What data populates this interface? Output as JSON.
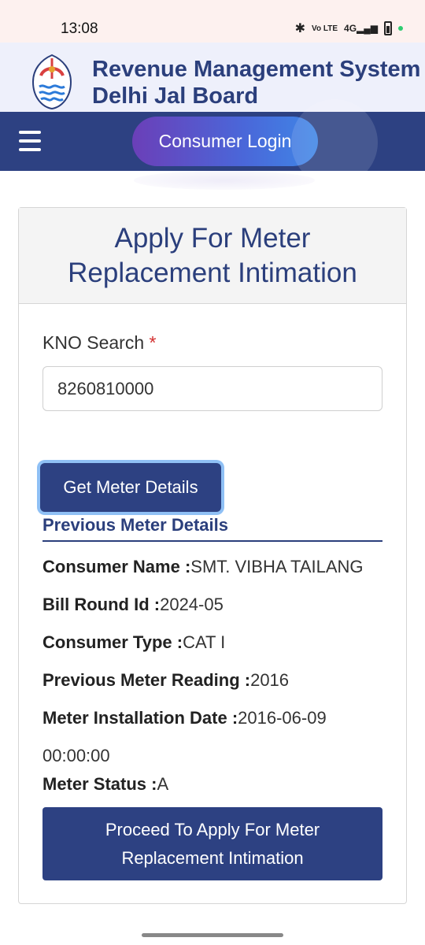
{
  "status_bar": {
    "time": "13:08",
    "icons": [
      "bluetooth-icon",
      "volte-icon",
      "signal-icon",
      "battery-icon"
    ],
    "volte_text": "Vo LTE",
    "network_text": "4G"
  },
  "header": {
    "title": "Revenue Management System",
    "subtitle": "Delhi Jal Board",
    "logo": "delhi-jal-board-logo"
  },
  "navbar": {
    "menu_icon": "hamburger-menu-icon",
    "login_label": "Consumer Login"
  },
  "form": {
    "title_line1": "Apply For Meter",
    "title_line2": "Replacement Intimation",
    "kno_label": "KNO Search",
    "required_mark": "*",
    "kno_value": "8260810000",
    "get_button": "Get Meter Details",
    "section_title": "Previous Meter Details"
  },
  "details": {
    "consumer_name_label": "Consumer Name :",
    "consumer_name_value": "SMT. VIBHA TAILANG",
    "bill_round_label": "Bill Round Id :",
    "bill_round_value": "2024-05",
    "consumer_type_label": "Consumer Type :",
    "consumer_type_value": "CAT I",
    "prev_reading_label": "Previous Meter Reading :",
    "prev_reading_value": "2016",
    "install_date_label": "Meter Installation Date :",
    "install_date_value": "2016-06-09",
    "install_time_value": "00:00:00",
    "status_label": "Meter Status :",
    "status_value": "A"
  },
  "proceed": {
    "line1": "Proceed To Apply For Meter",
    "line2": "Replacement Intimation"
  },
  "colors": {
    "primary": "#2d4182",
    "title_text": "#2b3f7c",
    "required": "#d32f2f",
    "status_bar_bg": "#fdf1ef",
    "header_bg": "#eef0fb"
  }
}
